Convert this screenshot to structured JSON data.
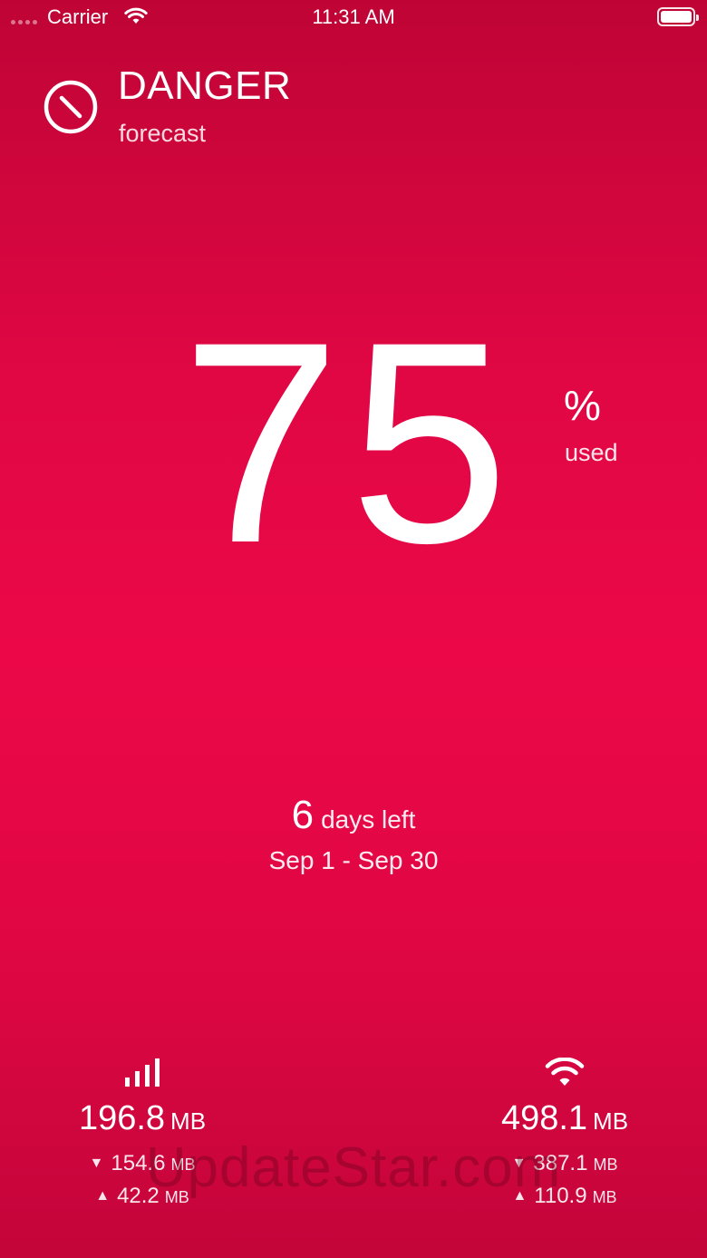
{
  "status_bar": {
    "carrier": "Carrier",
    "time": "11:31 AM"
  },
  "header": {
    "status_title": "DANGER",
    "status_subtitle": "forecast",
    "icon": "prohibited-icon"
  },
  "usage": {
    "percent_value": "75",
    "percent_sign": "%",
    "percent_label": "used"
  },
  "period": {
    "days_left_value": "6",
    "days_left_label": "days left",
    "date_range": "Sep 1 - Sep 30"
  },
  "cellular": {
    "icon": "cellular-signal-icon",
    "total_value": "196.8",
    "total_unit": "MB",
    "download_value": "154.6",
    "download_unit": "MB",
    "upload_value": "42.2",
    "upload_unit": "MB"
  },
  "wifi": {
    "icon": "wifi-icon",
    "total_value": "498.1",
    "total_unit": "MB",
    "download_value": "387.1",
    "download_unit": "MB",
    "upload_value": "110.9",
    "upload_unit": "MB"
  },
  "arrows": {
    "down": "▼",
    "up": "▲"
  },
  "watermark": "UpdateStar.com",
  "colors": {
    "background_top": "#bf0435",
    "background_mid": "#ec0848",
    "text": "#ffffff"
  }
}
